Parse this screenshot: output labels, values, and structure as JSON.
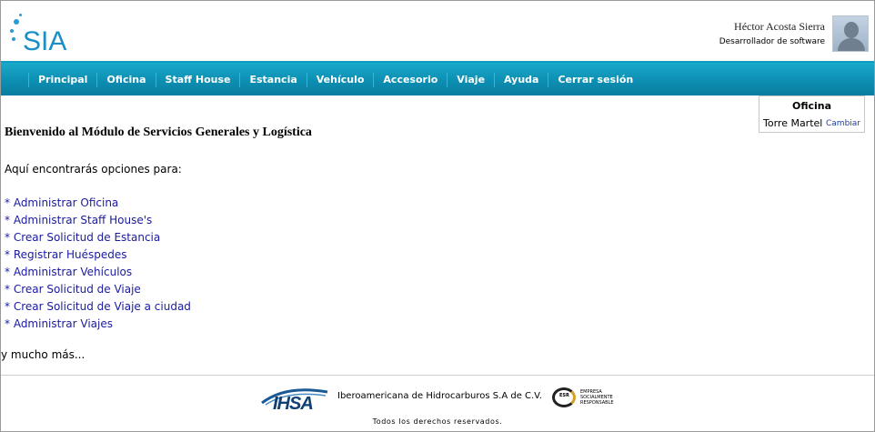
{
  "brand": {
    "logo_text": "SIA",
    "accent": "#1a8fc7",
    "nav_color": "#0c8fb3"
  },
  "user": {
    "name": "Héctor Acosta Sierra",
    "role": "Desarrollador de software"
  },
  "nav": {
    "items": [
      "Principal",
      "Oficina",
      "Staff House",
      "Estancia",
      "Vehículo",
      "Accesorio",
      "Viaje",
      "Ayuda",
      "Cerrar sesión"
    ]
  },
  "office": {
    "title": "Oficina",
    "name": "Torre Martel",
    "change_label": "Cambiar"
  },
  "content": {
    "welcome": "Bienvenido al Módulo de Servicios Generales y Logística",
    "intro": "Aquí encontrarás opciones para:",
    "links": [
      "* Administrar Oficina",
      "* Administrar Staff House's",
      "* Crear Solicitud de Estancia",
      "* Registrar Huéspedes",
      "* Administrar Vehículos",
      "* Crear Solicitud de Viaje",
      "* Crear Solicitud de Viaje a ciudad",
      "* Administrar Viajes"
    ],
    "more": "y mucho más..."
  },
  "footer": {
    "ihsa_logo_text": "IHSA",
    "company": "Iberoamericana de Hidrocarburos S.A de C.V.",
    "esr_label": "ESR",
    "esr_lines": [
      "EMPRESA",
      "SOCIALMENTE",
      "RESPONSABLE"
    ],
    "rights": "Todos los derechos reservados."
  }
}
